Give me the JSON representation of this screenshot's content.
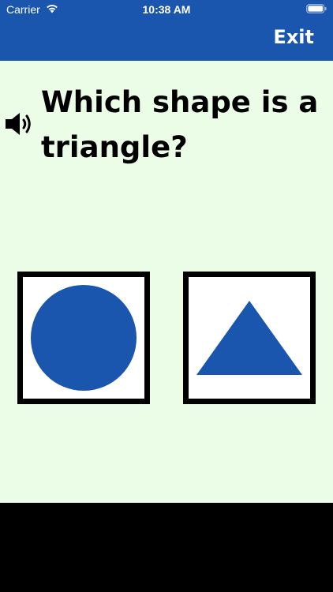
{
  "status_bar": {
    "carrier": "Carrier",
    "time": "10:38 AM",
    "wifi_icon": "wifi-icon",
    "battery_icon": "battery-icon"
  },
  "header": {
    "exit_label": "Exit",
    "color": "#1a56ad"
  },
  "question": {
    "text": "Which shape is a triangle?",
    "audio_icon": "speaker-icon"
  },
  "choices": [
    {
      "shape": "circle",
      "color": "#1a56ad"
    },
    {
      "shape": "triangle",
      "color": "#1a56ad"
    }
  ],
  "colors": {
    "content_background": "#ebfde7",
    "shape_fill": "#1a56ad",
    "card_border": "#000000"
  }
}
